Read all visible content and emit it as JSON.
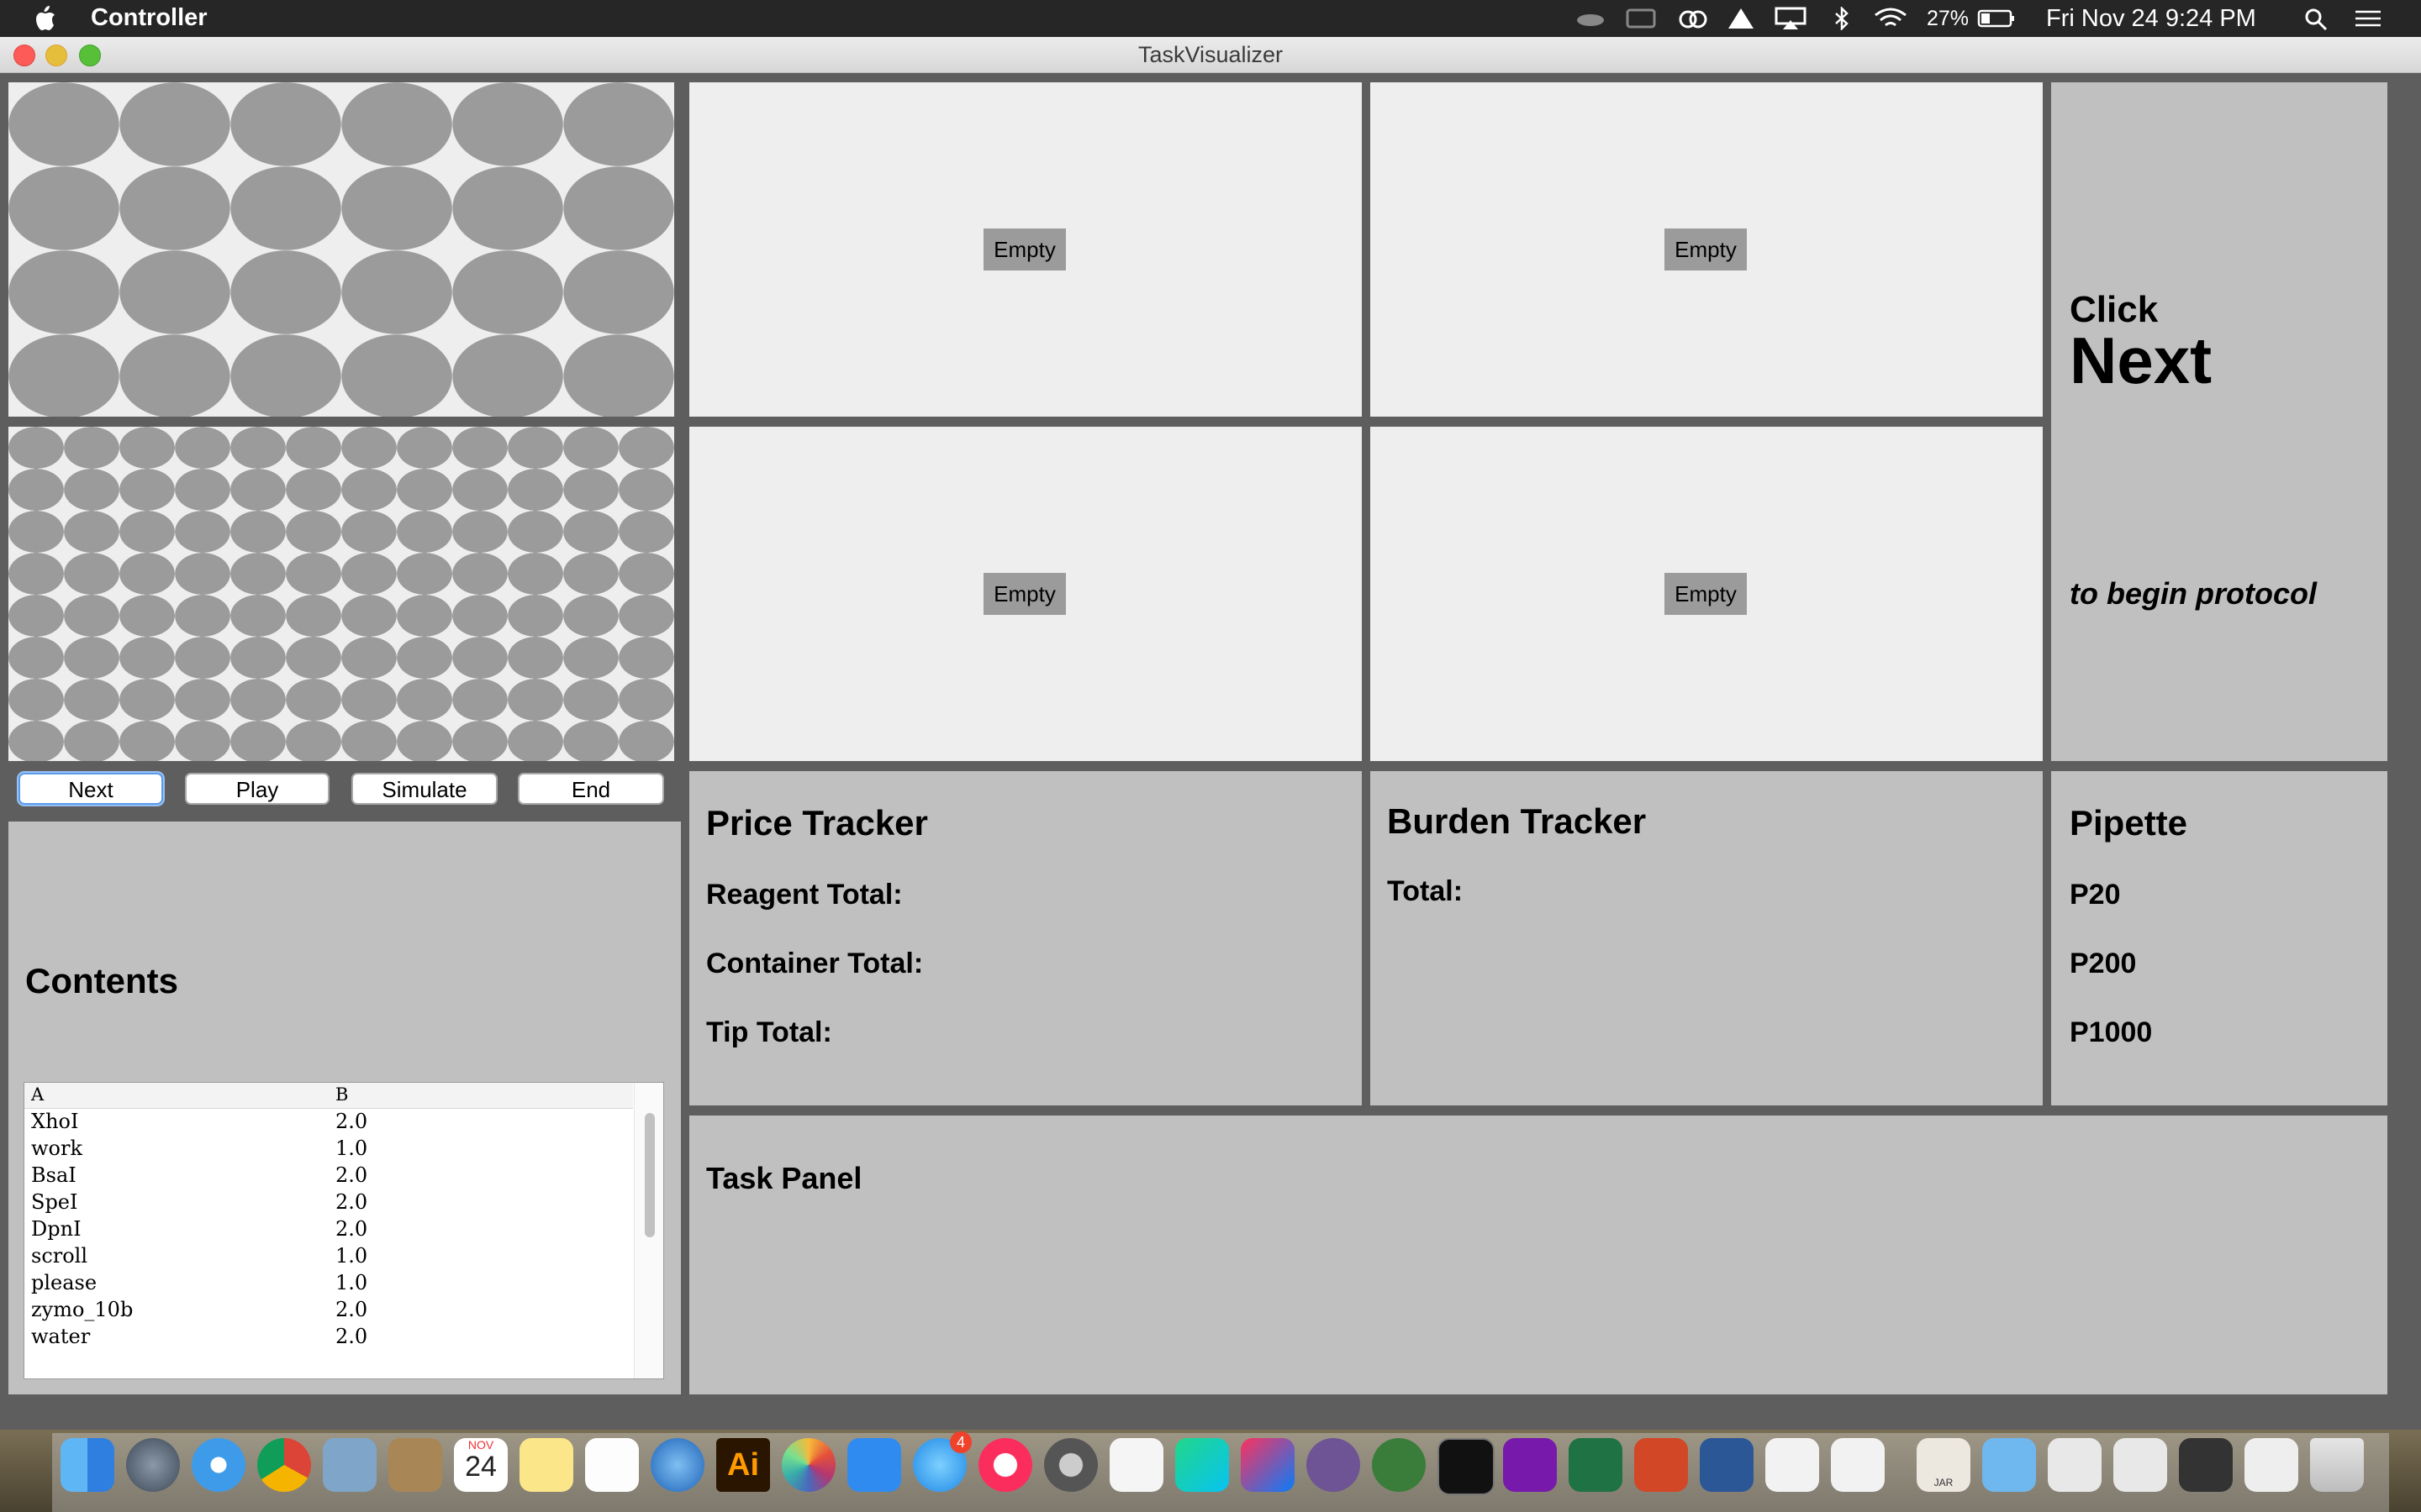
{
  "menubar": {
    "app_name": "Controller",
    "battery": "27%",
    "clock": "Fri Nov 24  9:24 PM"
  },
  "window": {
    "title": "TaskVisualizer"
  },
  "controls": {
    "next": "Next",
    "play": "Play",
    "simulate": "Simulate",
    "end": "End"
  },
  "slots": [
    "Empty",
    "Empty",
    "Empty",
    "Empty"
  ],
  "instruction": {
    "click": "Click",
    "next": "Next",
    "rest": "to begin protocol"
  },
  "contents": {
    "title": "Contents",
    "columns": [
      "A",
      "B"
    ],
    "rows": [
      {
        "a": "XhoI",
        "b": "2.0"
      },
      {
        "a": "work",
        "b": "1.0"
      },
      {
        "a": "BsaI",
        "b": "2.0"
      },
      {
        "a": "SpeI",
        "b": "2.0"
      },
      {
        "a": "DpnI",
        "b": "2.0"
      },
      {
        "a": "scroll",
        "b": "1.0"
      },
      {
        "a": "please",
        "b": "1.0"
      },
      {
        "a": "zymo_10b",
        "b": "2.0"
      },
      {
        "a": "water",
        "b": "2.0"
      }
    ]
  },
  "price_tracker": {
    "title": "Price Tracker",
    "reagent": "Reagent Total:",
    "container": "Container Total:",
    "tip": "Tip Total:"
  },
  "burden_tracker": {
    "title": "Burden Tracker",
    "total": "Total:"
  },
  "pipette": {
    "title": "Pipette",
    "p20": "P20",
    "p200": "P200",
    "p1000": "P1000"
  },
  "task_panel": {
    "title": "Task Panel"
  },
  "dock": {
    "calendar_month": "NOV",
    "calendar_day": "24",
    "messages_badge": "4",
    "jar_label": "JAR"
  }
}
